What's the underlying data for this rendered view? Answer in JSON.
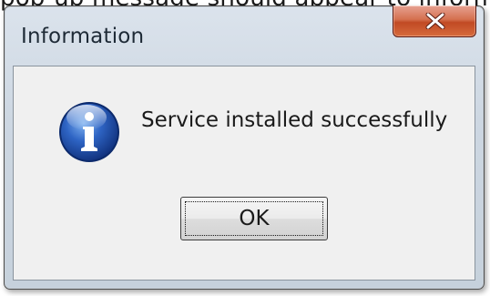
{
  "background": {
    "cropped_text": "pop-up message should appear to inform you"
  },
  "dialog": {
    "title": "Information",
    "close_glyph": "x",
    "icon": "information-icon",
    "message": "Service installed successfully",
    "ok_label": "OK"
  },
  "colors": {
    "close_button": "#c8512c",
    "info_icon_blue": "#1f4fa8",
    "client_background": "#f0f0f0"
  }
}
